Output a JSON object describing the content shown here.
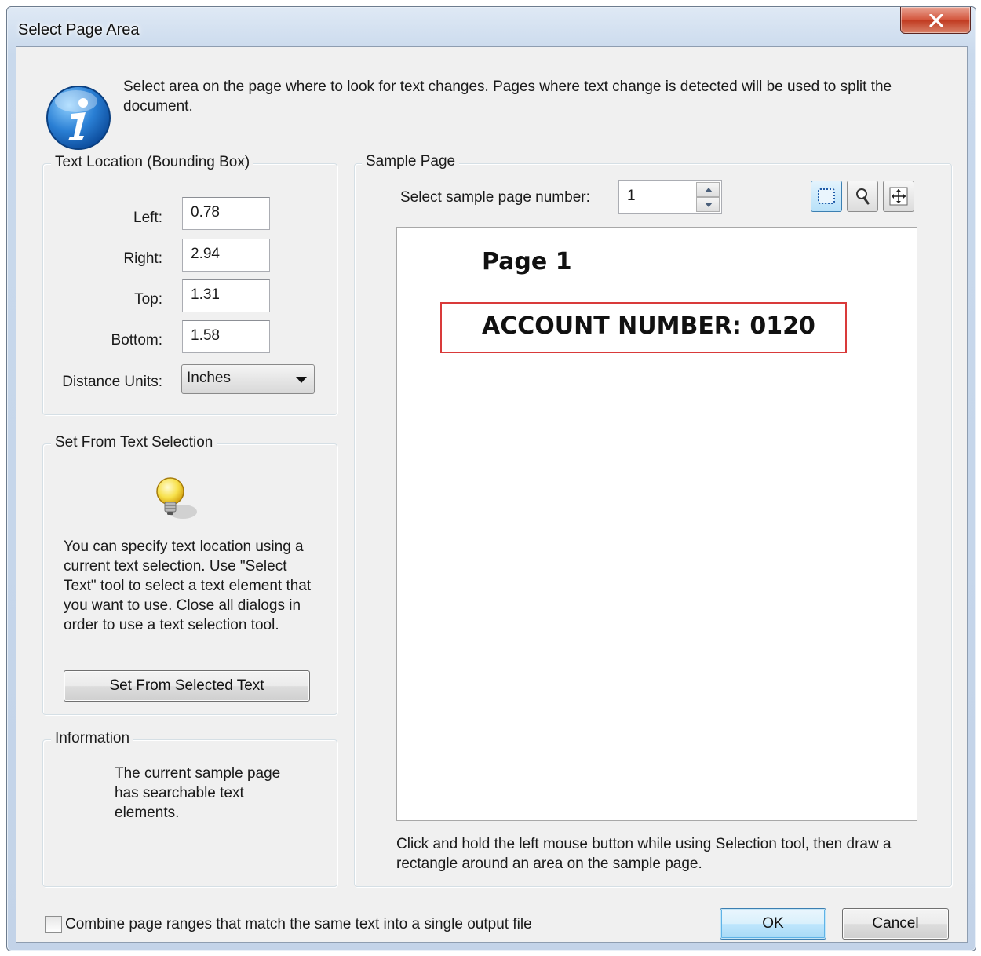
{
  "window": {
    "title": "Select Page Area"
  },
  "intro": {
    "text": "Select area on the page where to look for text changes. Pages where text change is detected will be used to split the document."
  },
  "text_location": {
    "title": "Text Location (Bounding Box)",
    "left_label": "Left:",
    "left_value": "0.78",
    "right_label": "Right:",
    "right_value": "2.94",
    "top_label": "Top:",
    "top_value": "1.31",
    "bottom_label": "Bottom:",
    "bottom_value": "1.58",
    "units_label": "Distance Units:",
    "units_value": "Inches"
  },
  "set_from_selection": {
    "title": "Set From Text Selection",
    "description": "You can specify text location using a current text selection.  Use \"Select Text\" tool to select a text element that you want to use. Close all dialogs in order to use a text selection tool.",
    "button_label": "Set From Selected Text"
  },
  "information": {
    "title": "Information",
    "text": "The current sample page has searchable text elements."
  },
  "sample_page": {
    "title": "Sample Page",
    "page_number_label": "Select sample page number:",
    "page_number_value": "1",
    "preview_heading": "Page 1",
    "preview_text": "ACCOUNT NUMBER: 0120",
    "hint": "Click and hold the left mouse button while using Selection tool, then draw a rectangle around an area on the sample page.",
    "tools": [
      "selection-tool",
      "zoom-tool",
      "pan-tool"
    ]
  },
  "footer": {
    "combine_label": "Combine page ranges that match the same text into a single output file",
    "combine_checked": false,
    "ok_label": "OK",
    "cancel_label": "Cancel"
  }
}
